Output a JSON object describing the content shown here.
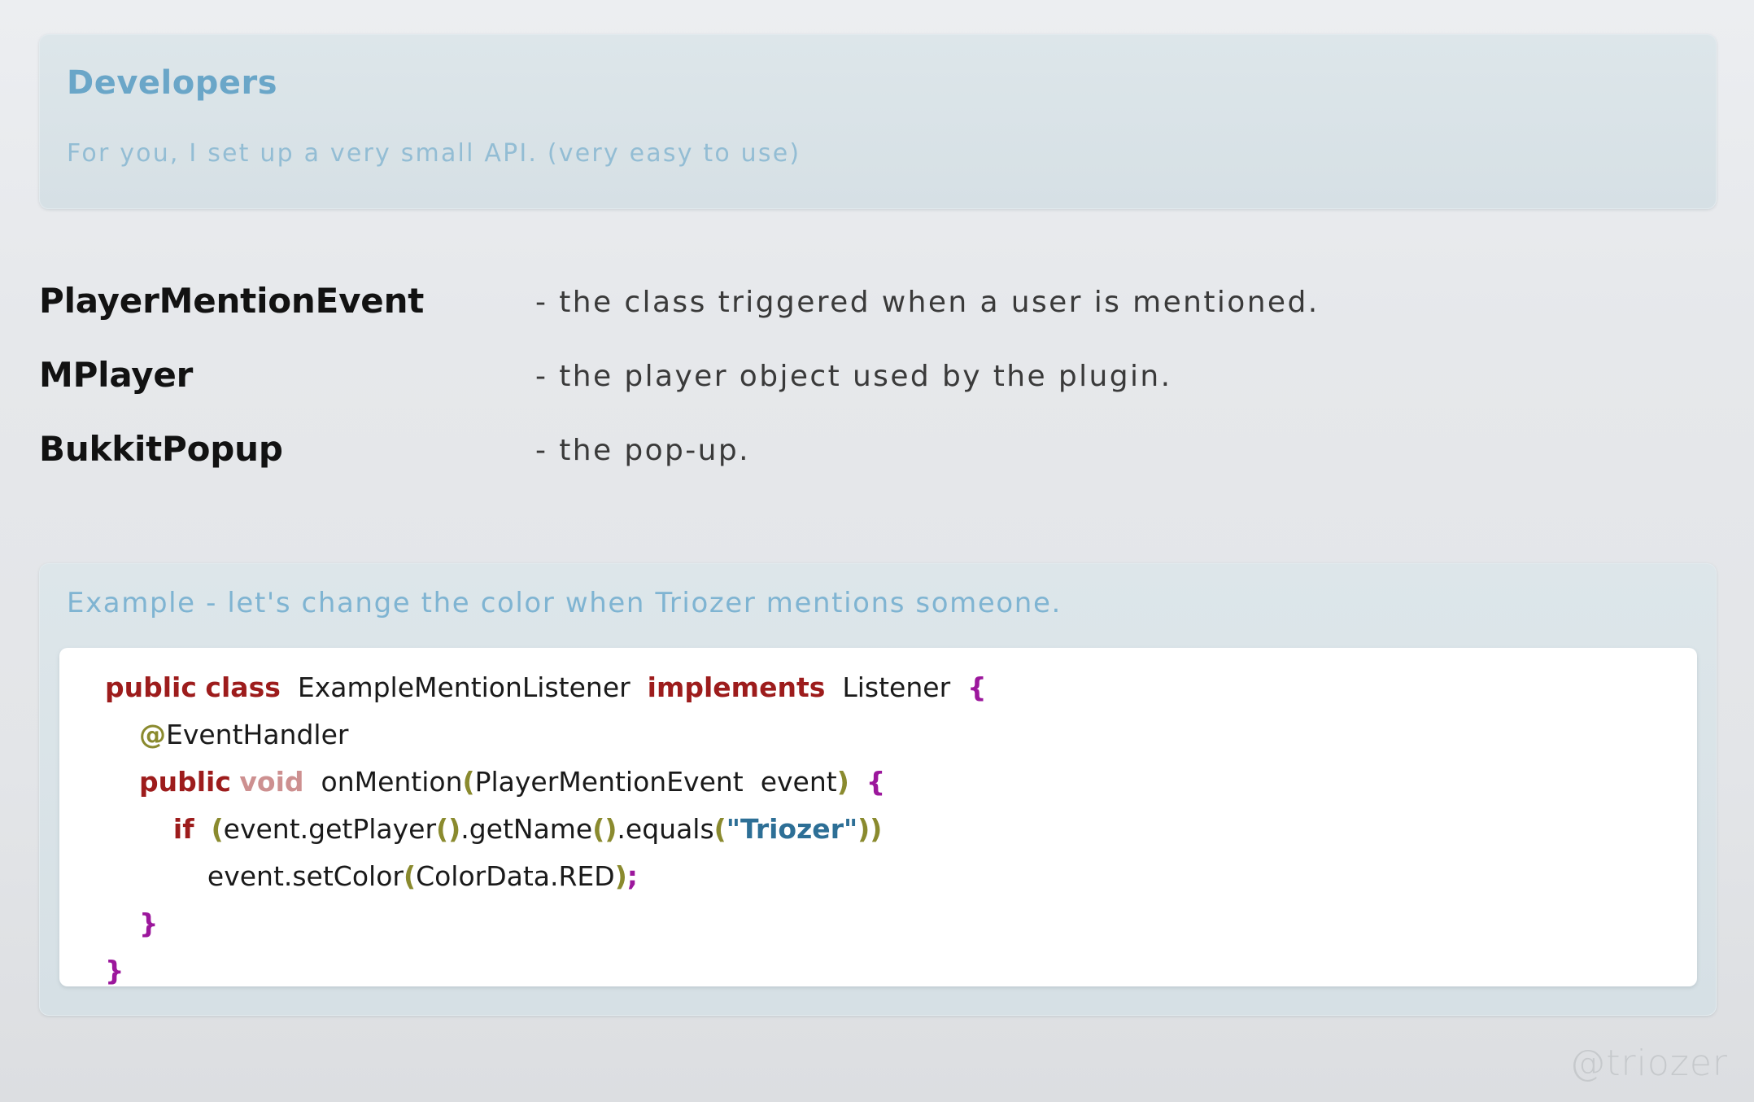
{
  "header": {
    "title": "Developers",
    "subtitle": "For you, I set up a very small API. (very easy to use)"
  },
  "definitions": [
    {
      "term": "PlayerMentionEvent",
      "desc": "-  the  class  triggered  when  a  user  is  mentioned."
    },
    {
      "term": "MPlayer",
      "desc": "-  the  player  object  used  by  the  plugin."
    },
    {
      "term": "BukkitPopup",
      "desc": "-  the  pop-up."
    }
  ],
  "example": {
    "title": "Example - let's change the color when Triozer mentions someone.",
    "code_lines": [
      {
        "indent": 0,
        "tokens": [
          {
            "t": "public",
            "c": "kw"
          },
          {
            "t": " ",
            "c": "plain"
          },
          {
            "t": "class",
            "c": "kw"
          },
          {
            "t": "  ",
            "c": "plain"
          },
          {
            "t": "ExampleMentionListener",
            "c": "plain"
          },
          {
            "t": "  ",
            "c": "plain"
          },
          {
            "t": "implements",
            "c": "kw"
          },
          {
            "t": "  ",
            "c": "plain"
          },
          {
            "t": "Listener",
            "c": "plain"
          },
          {
            "t": "  ",
            "c": "plain"
          },
          {
            "t": "{",
            "c": "brace"
          }
        ]
      },
      {
        "indent": 1,
        "tokens": [
          {
            "t": "@",
            "c": "anno"
          },
          {
            "t": "EventHandler",
            "c": "plain"
          }
        ]
      },
      {
        "indent": 1,
        "tokens": [
          {
            "t": "public",
            "c": "kw"
          },
          {
            "t": " ",
            "c": "plain"
          },
          {
            "t": "void",
            "c": "type"
          },
          {
            "t": "  ",
            "c": "plain"
          },
          {
            "t": "onMention",
            "c": "plain"
          },
          {
            "t": "(",
            "c": "paren"
          },
          {
            "t": "PlayerMentionEvent  event",
            "c": "plain"
          },
          {
            "t": ")",
            "c": "paren"
          },
          {
            "t": "  ",
            "c": "plain"
          },
          {
            "t": "{",
            "c": "brace"
          }
        ]
      },
      {
        "indent": 2,
        "tokens": [
          {
            "t": "if",
            "c": "kw"
          },
          {
            "t": "  ",
            "c": "plain"
          },
          {
            "t": "(",
            "c": "paren"
          },
          {
            "t": "event.getPlayer",
            "c": "plain"
          },
          {
            "t": "()",
            "c": "paren"
          },
          {
            "t": ".getName",
            "c": "plain"
          },
          {
            "t": "()",
            "c": "paren"
          },
          {
            "t": ".equals",
            "c": "plain"
          },
          {
            "t": "(",
            "c": "paren"
          },
          {
            "t": "\"Triozer\"",
            "c": "string"
          },
          {
            "t": "))",
            "c": "paren"
          }
        ]
      },
      {
        "indent": 3,
        "tokens": [
          {
            "t": "event.setColor",
            "c": "plain"
          },
          {
            "t": "(",
            "c": "paren"
          },
          {
            "t": "ColorData.RED",
            "c": "plain"
          },
          {
            "t": ")",
            "c": "paren"
          },
          {
            "t": ";",
            "c": "semi"
          }
        ]
      },
      {
        "indent": 1,
        "tokens": [
          {
            "t": "}",
            "c": "brace"
          }
        ]
      },
      {
        "indent": 0,
        "tokens": [
          {
            "t": "}",
            "c": "brace"
          }
        ]
      }
    ]
  },
  "watermark": "@triozer",
  "colors": {
    "page_background": "#e5e7ea",
    "panel_background": "#dbe4e9",
    "panel_border": "#e2eaee",
    "accent_blue": "#6aa6c8",
    "subtitle_blue": "#93bdd4",
    "example_title_blue": "#7fb4d2",
    "term_black": "#121212",
    "desc_gray": "#3a3a3a",
    "code_card": "#ffffff",
    "keyword_red": "#9d1c1c",
    "type_rose": "#cd9090",
    "brace_purple": "#9c179c",
    "paren_olive": "#8a8a2e",
    "string_blue": "#2d6f96",
    "watermark_gray": "#c6c9cc"
  }
}
